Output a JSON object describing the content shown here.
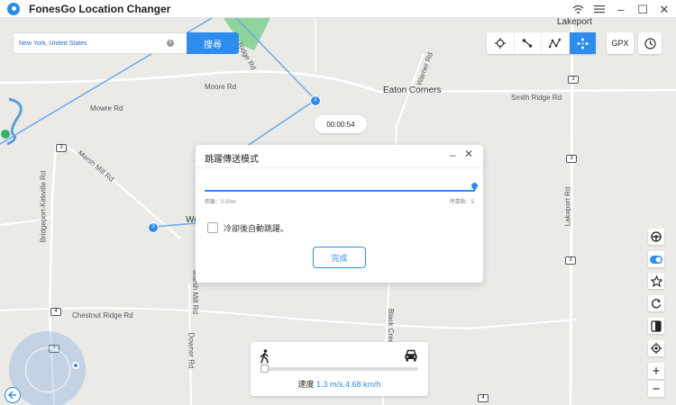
{
  "app": {
    "title": "FonesGo Location Changer"
  },
  "window_controls": {
    "wifi": "wifi-icon",
    "menu": "menu-icon",
    "minimize": "–",
    "maximize": "☐",
    "close": "✕"
  },
  "search": {
    "value": "New York, United States",
    "button_label": "搜尋",
    "clear_icon": "×"
  },
  "toolbar": {
    "gpx_label": "GPX",
    "active_mode": "jump-teleport-mode"
  },
  "map": {
    "roads": [
      "Moore Rd",
      "Mowre Rd",
      "Ridge Rd",
      "Warner Rd",
      "Smith Ridge Rd",
      "Marsh Mill Rd",
      "Bridgeport-Kirkville Rd",
      "Chestnut Ridge Rd",
      "Marsh Mill Rd",
      "Black Creek",
      "Downer Rd",
      "Lakeport Rd"
    ],
    "towns": [
      "Eaton Corners",
      "Lakeport",
      "We"
    ],
    "shields": [
      "3",
      "3",
      "3",
      "3",
      "4",
      "1",
      "4"
    ],
    "waypoints": [
      "2",
      "3"
    ]
  },
  "timer": {
    "text": "00:00:54"
  },
  "dialog": {
    "title": "跳躍傳送模式",
    "minimize": "–",
    "close": "✕",
    "distance_label": "距離：0.00m",
    "stops_label": "停靠點：5",
    "checkbox_label": "冷卻後自動跳躍。",
    "finish_label": "完成",
    "progress": 1.0
  },
  "speed": {
    "prefix": "速度 ",
    "value": "1.3 m/s,4.68 km/h",
    "level": 0.0
  },
  "side_tools": [
    "steering-wheel-icon",
    "toggle-icon",
    "star-icon",
    "refresh-icon",
    "phone-icon",
    "locate-icon",
    "zoom-in-icon",
    "zoom-out-icon"
  ],
  "zoom": {
    "in": "+",
    "out": "−"
  },
  "colors": {
    "accent": "#2d8cf0",
    "map_bg": "#ebeae7",
    "park": "#8fd49a"
  }
}
